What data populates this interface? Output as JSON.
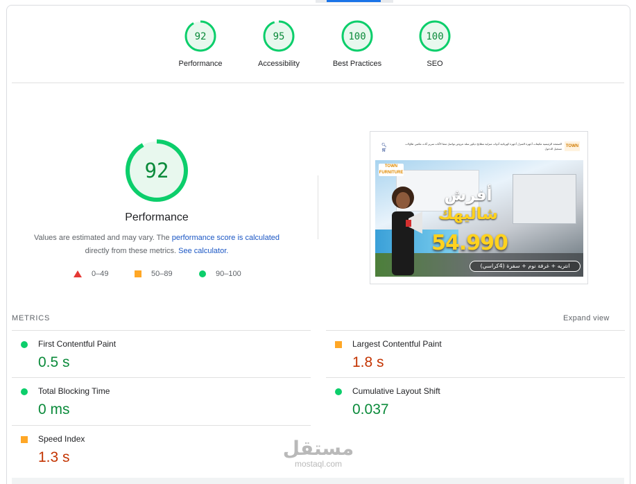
{
  "categories": [
    {
      "name": "Performance",
      "score": "92",
      "value": 92
    },
    {
      "name": "Accessibility",
      "score": "95",
      "value": 95
    },
    {
      "name": "Best Practices",
      "score": "100",
      "value": 100
    },
    {
      "name": "SEO",
      "score": "100",
      "value": 100
    }
  ],
  "performance": {
    "score": "92",
    "value": 92,
    "title": "Performance",
    "desc_part1": "Values are estimated and may vary. The ",
    "desc_link1": "performance score is calculated",
    "desc_part2": " directly from these metrics. ",
    "desc_link2": "See calculator."
  },
  "legend": {
    "fail": "0–49",
    "average": "50–89",
    "pass": "90–100"
  },
  "screenshot": {
    "logo": "TOWN",
    "nav_links": "الصفحة الرئيسية  مكيفات  أجهزة المنزل  أجهزة كهربائية  أدوات منزلية  مطابخ  ديكور  سلة  عروض  تواصل معنا  الأثاث  سرير  أثاث مكتبي  طاولات  تسجيل الدخول",
    "banner_logo": "TOWN FURNITURE",
    "headline_1": "أفرش",
    "headline_2": "شاليهك",
    "price": "54.990",
    "pill_text": "انتريه + غرفة نوم + سفرة (4كراسي)"
  },
  "metrics": {
    "label": "METRICS",
    "expand_label": "Expand view",
    "items": [
      {
        "name": "First Contentful Paint",
        "value": "0.5 s",
        "rating": "good"
      },
      {
        "name": "Largest Contentful Paint",
        "value": "1.8 s",
        "rating": "average"
      },
      {
        "name": "Total Blocking Time",
        "value": "0 ms",
        "rating": "good"
      },
      {
        "name": "Cumulative Layout Shift",
        "value": "0.037",
        "rating": "good"
      },
      {
        "name": "Speed Index",
        "value": "1.3 s",
        "rating": "average"
      }
    ]
  },
  "watermark": {
    "arabic": "مستقل",
    "latin": "mostaql.com"
  },
  "colors": {
    "pass": "#0cce6b",
    "pass_text": "#0a8a3a",
    "pass_fill": "#e8f8ee",
    "average": "#ffa726",
    "average_text": "#c33300",
    "fail": "#e53935",
    "link": "#1a56c4"
  }
}
